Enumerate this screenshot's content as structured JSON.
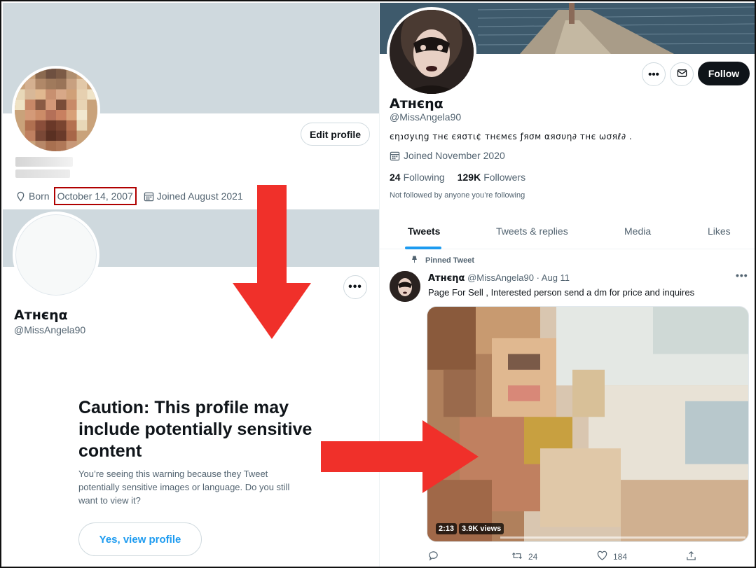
{
  "left_top_profile": {
    "edit_button": "Edit profile",
    "born_label": "Born",
    "born_date": "October 14, 2007",
    "joined": "Joined August 2021"
  },
  "left_bottom_profile": {
    "name": "Aтнєηα",
    "handle": "@MissAngela90",
    "more_button": "•••",
    "caution_title": "Caution: This profile may include potentially sensitive content",
    "caution_text": "You’re seeing this warning because they Tweet potentially sensitive images or language. Do you still want to view it?",
    "view_button": "Yes, view profile"
  },
  "right_profile": {
    "name": "Aтнєηα",
    "handle": "@MissAngela90",
    "bio": "єηנσуιηg тнє єяσтι¢ тнємєѕ ƒяσм αяσυη∂ тнє ωσяℓ∂ .",
    "joined": "Joined November 2020",
    "following_count": "24",
    "following_label": "Following",
    "followers_count": "129K",
    "followers_label": "Followers",
    "not_followed": "Not followed by anyone you’re following",
    "follow_button": "Follow",
    "more_button": "•••",
    "tabs": [
      "Tweets",
      "Tweets & replies",
      "Media",
      "Likes"
    ]
  },
  "tweet": {
    "pinned_label": "Pinned Tweet",
    "author": "Aтнєηα",
    "meta": "@MissAngela90 · Aug 11",
    "more": "•••",
    "text": "Page For Sell , Interested person send a dm for price and inquires",
    "video_duration": "2:13",
    "video_views": "3.9K views",
    "retweets": "24",
    "likes": "184"
  },
  "colors": {
    "accent": "#1d9bf0",
    "arrow_red": "#f0302a",
    "highlight_box": "#b00000",
    "banner_gray": "#cfd9de"
  },
  "icons": [
    "location-icon",
    "calendar-icon",
    "mail-icon",
    "pin-icon",
    "reply-icon",
    "retweet-icon",
    "like-icon",
    "share-icon"
  ]
}
